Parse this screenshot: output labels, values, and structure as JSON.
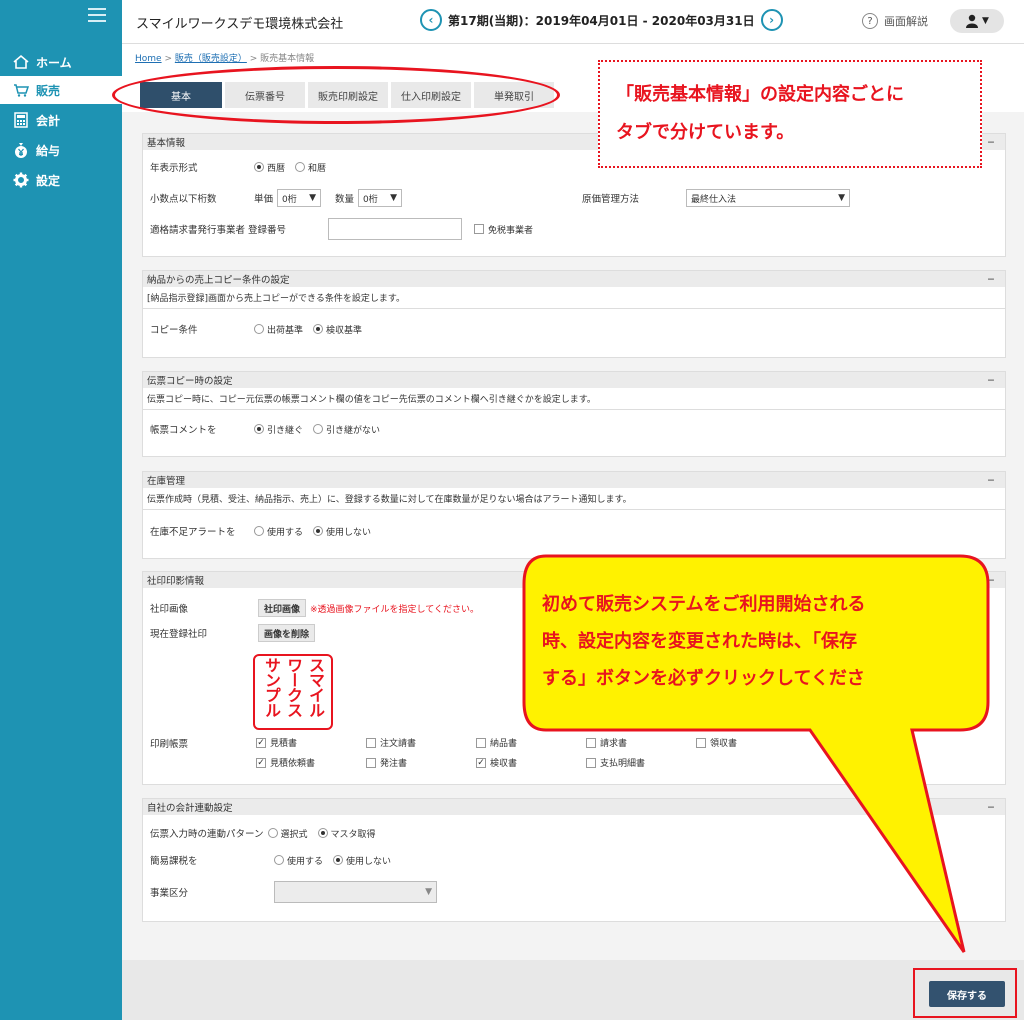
{
  "sidebar": {
    "items": [
      {
        "label": "ホーム",
        "icon": "home-icon"
      },
      {
        "label": "販売",
        "icon": "cart-icon"
      },
      {
        "label": "会計",
        "icon": "calculator-icon"
      },
      {
        "label": "給与",
        "icon": "yen-bag-icon"
      },
      {
        "label": "設定",
        "icon": "gear-icon"
      }
    ]
  },
  "header": {
    "company": "スマイルワークスデモ環境株式会社",
    "period": "第17期(当期)：2019年04月01日 - 2020年03月31日",
    "help": "画面解説"
  },
  "breadcrumb": {
    "home": "Home",
    "sep1": " > ",
    "settings": "販売（販売設定）",
    "sep2": " > ",
    "current": "販売基本情報"
  },
  "tabs": [
    "基本",
    "伝票番号",
    "販売印刷設定",
    "仕入印刷設定",
    "単発取引"
  ],
  "basic": {
    "title": "基本情報",
    "collapse": "−",
    "year_format_label": "年表示形式",
    "year_western": "西暦",
    "year_japanese": "和暦",
    "decimal_label": "小数点以下桁数",
    "unit_price_label": "単価",
    "unit_price_value": "0桁",
    "quantity_label": "数量",
    "quantity_value": "0桁",
    "cost_method_label": "原価管理方法",
    "cost_method_value": "最終仕入法",
    "invoice_label": "適格請求書発行事業者 登録番号",
    "invoice_value": "",
    "tax_exempt_label": "免税事業者"
  },
  "copy_delivery": {
    "title": "納品からの売上コピー条件の設定",
    "collapse": "−",
    "desc": "[納品指示登録]画面から売上コピーができる条件を設定します。",
    "label": "コピー条件",
    "opt1": "出荷基準",
    "opt2": "検収基準"
  },
  "copy_slip": {
    "title": "伝票コピー時の設定",
    "collapse": "−",
    "desc": "伝票コピー時に、コピー元伝票の帳票コメント欄の値をコピー先伝票のコメント欄へ引き継ぐかを設定します。",
    "label": "帳票コメントを",
    "opt1": "引き継ぐ",
    "opt2": "引き継がない"
  },
  "stock": {
    "title": "在庫管理",
    "collapse": "−",
    "desc": "伝票作成時（見積、受注、納品指示、売上）に、登録する数量に対して在庫数量が足りない場合はアラート通知します。",
    "label": "在庫不足アラートを",
    "opt1": "使用する",
    "opt2": "使用しない"
  },
  "seal": {
    "title": "社印印影情報",
    "collapse": "−",
    "image_label": "社印画像",
    "image_button": "社印画像",
    "image_note": "※透過画像ファイルを指定してください。",
    "current_label": "現在登録社印",
    "delete_button": "画像を削除",
    "stamp_text": "スマイルワークスサンプル",
    "print_label": "印刷帳票",
    "forms": [
      {
        "label": "見積書",
        "checked": true
      },
      {
        "label": "注文請書",
        "checked": false
      },
      {
        "label": "納品書",
        "checked": false
      },
      {
        "label": "請求書",
        "checked": false
      },
      {
        "label": "領収書",
        "checked": false
      },
      {
        "label": "見積依頼書",
        "checked": true
      },
      {
        "label": "発注書",
        "checked": false
      },
      {
        "label": "検収書",
        "checked": true
      },
      {
        "label": "支払明細書",
        "checked": false
      }
    ]
  },
  "accounting": {
    "title": "自社の会計連動設定",
    "collapse": "−",
    "pattern_label": "伝票入力時の連動パターン",
    "pattern_opt1": "選択式",
    "pattern_opt2": "マスタ取得",
    "simple_tax_label": "簡易課税を",
    "simple_opt1": "使用する",
    "simple_opt2": "使用しない",
    "business_label": "事業区分",
    "business_value": ""
  },
  "save_button": "保存する",
  "annotations": {
    "tabs_note": [
      "「販売基本情報」の設定内容ごとに",
      "タブで分けています。"
    ],
    "save_note": [
      "初めて販売システムをご利用開始される",
      "時、設定内容を変更された時は、「保存",
      "する」ボタンを必ずクリックしてくださ"
    ]
  },
  "colors": {
    "sidebar": "#1e93b3",
    "active_tab": "#2f4f6b",
    "save": "#33526f",
    "annotation": "#e8141f",
    "callout_fill": "#fff200"
  }
}
